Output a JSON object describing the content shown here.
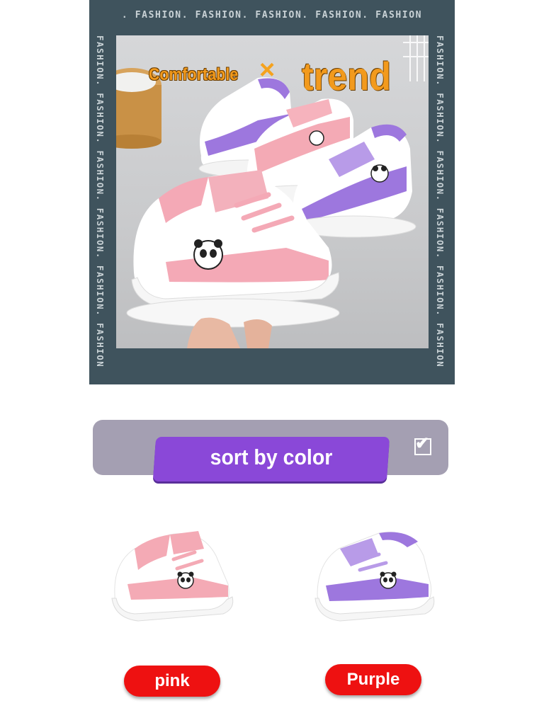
{
  "hero": {
    "top_border_text": ". FASHION. FASHION. FASHION. FASHION. FASHION",
    "left_border_text": "FASHION. FASHION. FASHION. FASHION. FASHION. FASHION. . .",
    "right_border_text": "FASHION. FASHION. FASHION. FASHION. FASHION. FASHION. . .",
    "headline_left": "Comfortable",
    "headline_cross": "×",
    "headline_right": "trend"
  },
  "sort": {
    "label": "sort by color",
    "checked": true,
    "check_glyph": "✔"
  },
  "products": [
    {
      "color_label": "pink",
      "accent": "#f3a6b3",
      "icon": "panda-sneaker-pink"
    },
    {
      "color_label": "Purple",
      "accent": "#9f78e0",
      "icon": "panda-sneaker-purple"
    }
  ],
  "colors": {
    "hero_frame": "#3f535d",
    "sort_bar": "#a49fb2",
    "sort_button": "#8a48d8",
    "pill_red": "#ee1111",
    "headline_orange": "#f29a1d"
  }
}
